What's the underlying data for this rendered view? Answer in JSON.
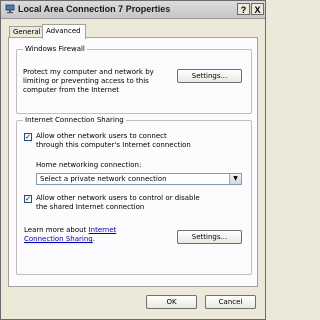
{
  "window": {
    "title": "Local Area Connection 7 Properties",
    "help_button": "?",
    "close_button": "X"
  },
  "tabs": [
    {
      "label": "General",
      "active": false
    },
    {
      "label": "Advanced",
      "active": true
    }
  ],
  "firewall": {
    "title": "Windows Firewall",
    "description": "Protect my computer and network by limiting or preventing access to this computer from the Internet",
    "settings_label": "Settings..."
  },
  "ics": {
    "title": "Internet Connection Sharing",
    "allow_connect": {
      "label": "Allow other network users to connect through this computer's Internet connection",
      "checked": true
    },
    "home_label": "Home networking connection:",
    "home_select": {
      "value": "Select a private network connection"
    },
    "allow_control": {
      "label": "Allow other network users to control or disable the shared Internet connection",
      "checked": true
    },
    "learn_prefix": "Learn more about ",
    "learn_link": "Internet Connection Sharing",
    "learn_suffix": ".",
    "settings_label": "Settings..."
  },
  "footer": {
    "ok_label": "OK",
    "cancel_label": "Cancel"
  },
  "colors": {
    "link": "#0000cc",
    "checkbox_border": "#1c5180"
  }
}
